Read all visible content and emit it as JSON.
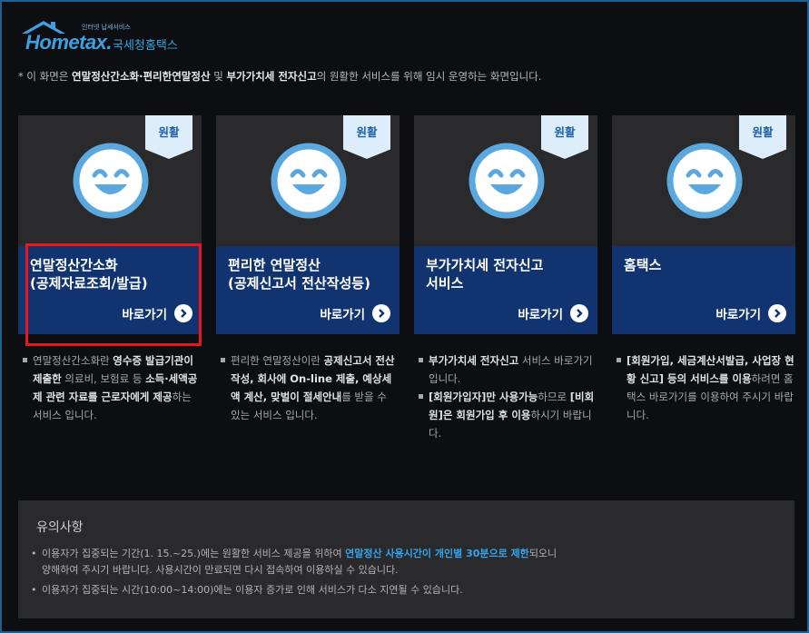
{
  "header": {
    "logo_small": "인터넷 납세서비스",
    "logo_brand": "Hometax.",
    "logo_org": "국세청홈택스"
  },
  "notice": {
    "prefix": "* 이 화면은 ",
    "bold1": "연말정산간소화·편리한연말정산",
    "mid1": " 및 ",
    "bold2": "부가가치세 전자신고",
    "suffix": "의 원활한 서비스를 위해 임시 운영하는 화면입니다."
  },
  "cards": [
    {
      "badge": "원활",
      "title_line1": "연말정산간소화",
      "title_line2": "(공제자료조회/발급)",
      "go_label": "바로가기",
      "desc": [
        [
          {
            "t": "연말정산간소화란 ",
            "b": false
          },
          {
            "t": "영수증 발급기관이 제출한",
            "b": true
          },
          {
            "t": " 의료비, 보험료 등 ",
            "b": false
          },
          {
            "t": "소득·세액공제 관련 자료를 근로자에게 제공",
            "b": true
          },
          {
            "t": "하는 서비스 입니다.",
            "b": false
          }
        ]
      ]
    },
    {
      "badge": "원활",
      "title_line1": "편리한 연말정산",
      "title_line2": "(공제신고서 전산작성등)",
      "go_label": "바로가기",
      "desc": [
        [
          {
            "t": "편리한 연말정산이란 ",
            "b": false
          },
          {
            "t": "공제신고서 전산작성, 회사에 On-line 제출, 예상세액 계산, 맞벌이 절세안내",
            "b": true
          },
          {
            "t": "를 받을 수 있는 서비스 입니다.",
            "b": false
          }
        ]
      ]
    },
    {
      "badge": "원활",
      "title_line1": "부가가치세 전자신고",
      "title_line2": "서비스",
      "go_label": "바로가기",
      "desc": [
        [
          {
            "t": "부가가치세 전자신고",
            "b": true
          },
          {
            "t": " 서비스 바로가기 입니다.",
            "b": false
          }
        ],
        [
          {
            "t": "[회원가입자]만 사용가능",
            "b": true
          },
          {
            "t": "하므로 ",
            "b": false
          },
          {
            "t": "[비회원]은 회원가입 후 이용",
            "b": true
          },
          {
            "t": "하시기 바랍니다.",
            "b": false
          }
        ]
      ]
    },
    {
      "badge": "원활",
      "title_line1": "홈택스",
      "title_line2": "",
      "go_label": "바로가기",
      "desc": [
        [
          {
            "t": "[회원가입, 세금계산서발급, 사업장 현황 신고] 등의 서비스를 이용",
            "b": true
          },
          {
            "t": "하려면 홈택스 바로가기를 이용하여 주시기 바랍니다.",
            "b": false
          }
        ]
      ]
    }
  ],
  "caution": {
    "title": "유의사항",
    "line1_a": "이용자가 집중되는 기간(1. 15.~25.)에는 원활한 서비스 제공을 위하여 ",
    "line1_hl": "연말정산 사용시간이 개인별 30분으로 제한",
    "line1_b": "되오니",
    "line1_c": "양해하여 주시기 바랍니다. 사용시간이 만료되면 다시 접속하여 이용하실 수 있습니다.",
    "line2": "이용자가 집중되는 시간(10:00~14:00)에는 이용자 증가로 인해 서비스가 다소 지연될 수 있습니다."
  },
  "colors": {
    "card_top": "#2a2a2c",
    "card_bottom": "#113470",
    "badge_bg": "#ddeefa",
    "highlight_border": "#e8171b",
    "accent": "#35a4ea"
  }
}
